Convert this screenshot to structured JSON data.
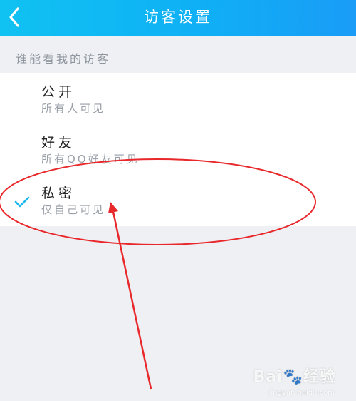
{
  "header": {
    "title": "访客设置",
    "back_icon": "chevron-left-icon",
    "background": "#10c2f2"
  },
  "section_label": "谁能看我的访客",
  "options": [
    {
      "title": "公开",
      "subtitle": "所有人可见",
      "selected": false
    },
    {
      "title": "好友",
      "subtitle": "所有QQ好友可见",
      "selected": false
    },
    {
      "title": "私密",
      "subtitle": "仅自己可见",
      "selected": true
    }
  ],
  "colors": {
    "check": "#1ab8f0",
    "annotation": "#e8282b"
  },
  "watermark": {
    "text": "Bai🐾经验",
    "sub": "jingyan.baidu.com"
  }
}
